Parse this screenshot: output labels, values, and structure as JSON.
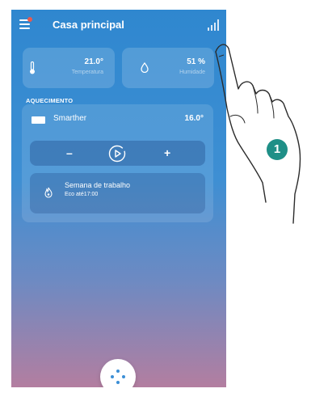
{
  "header": {
    "title": "Casa principal"
  },
  "sensors": {
    "temperature": {
      "value": "21.0°",
      "label": "Temperatura"
    },
    "humidity": {
      "value": "51 %",
      "label": "Humidade"
    }
  },
  "heating": {
    "section_title": "AQUECIMENTO",
    "device": {
      "name": "Smarther",
      "temperature": "16.0°"
    },
    "controls": {
      "minus": "–",
      "plus": "+"
    },
    "schedule": {
      "title": "Semana de trabalho",
      "subtitle": "Eco até17:00"
    }
  },
  "callout": {
    "number": "1"
  },
  "colors": {
    "accent": "#3c8fd6",
    "callout": "#1f8f87",
    "notification": "#e85a4f"
  },
  "icons": [
    "menu-icon",
    "stats-icon",
    "thermometer-icon",
    "droplet-icon",
    "thermostat-icon",
    "play-icon",
    "flame-icon",
    "dots-grid-icon"
  ]
}
